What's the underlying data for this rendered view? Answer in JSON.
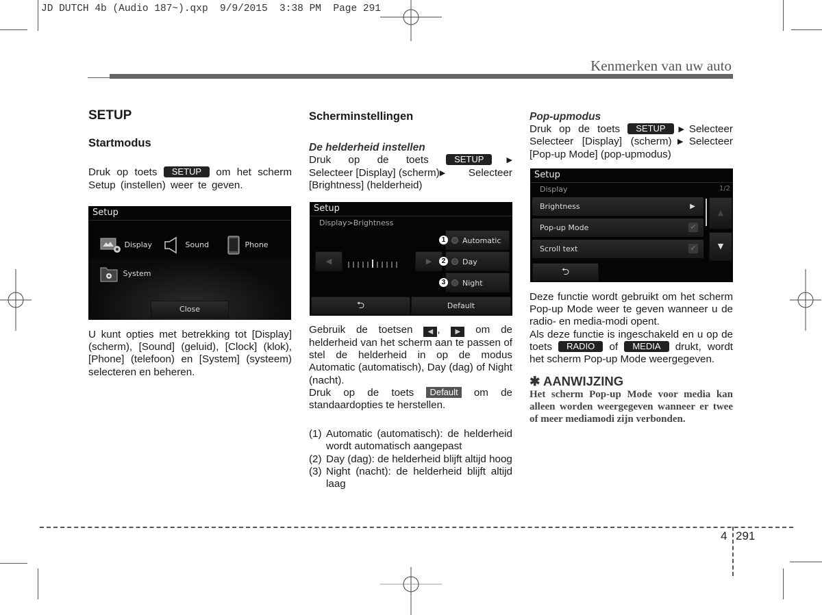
{
  "slug": "JD DUTCH 4b (Audio 187~).qxp  9/9/2015  3:38 PM  Page 291",
  "header": {
    "section_title": "Kenmerken van uw auto"
  },
  "col1": {
    "title": "SETUP",
    "subtitle": "Startmodus",
    "para1_pre": "Druk op toets",
    "para1_key": "SETUP",
    "para1_post": "om het scherm Setup (instellen) weer te geven.",
    "screen": {
      "title": "Setup",
      "items": [
        {
          "label": "Display",
          "icon": "display-settings-icon"
        },
        {
          "label": "Sound",
          "icon": "speaker-icon"
        },
        {
          "label": "Phone",
          "icon": "phone-icon"
        },
        {
          "label": "System",
          "icon": "system-folder-icon"
        }
      ],
      "close_label": "Close"
    },
    "para2": "U kunt opties met betrekking tot [Display] (scherm), [Sound] (geluid), [Clock] (klok), [Phone] (telefoon) en [System] (systeem) selecteren en beheren."
  },
  "col2": {
    "title": "Scherminstellingen",
    "subtitle": "De helderheid instellen",
    "instr_pre": "Druk op de toets",
    "instr_key": "SETUP",
    "instr_mid": "Selecteer [Display] (scherm)",
    "instr_post": "Selecteer [Brightness] (helderheid)",
    "screen": {
      "title": "Setup",
      "breadcrumb": "Display>Brightness",
      "brightness_level": 5,
      "brightness_steps": 11,
      "modes": [
        {
          "num": "1",
          "label": "Automatic"
        },
        {
          "num": "2",
          "label": "Day"
        },
        {
          "num": "3",
          "label": "Night"
        }
      ],
      "back_icon": "back-arrow-icon",
      "default_label": "Default"
    },
    "para1_pre": "Gebruik de toetsen",
    "para1_post": "om de helderheid van het scherm aan te passen of stel de helderheid in op de modus Automatic (automatisch), Day (dag) of Night (nacht).",
    "para2_pre": "Druk op de toets",
    "para2_key": "Default",
    "para2_post": "om de standaardopties te herstellen.",
    "list": [
      {
        "num": "(1)",
        "text": "Automatic (automatisch): de helderheid wordt automatisch aangepast"
      },
      {
        "num": "(2)",
        "text": "Day (dag): de helderheid blijft altijd hoog"
      },
      {
        "num": "(3)",
        "text": "Night (nacht): de helderheid blijft altijd laag"
      }
    ]
  },
  "col3": {
    "subtitle": "Pop-upmodus",
    "instr_pre": "Druk op de toets",
    "instr_key": "SETUP",
    "instr_mid": "Selecteer [Display] (scherm)",
    "instr_post": "Selecteer [Pop-up Mode] (pop-upmodus)",
    "screen": {
      "title": "Setup",
      "section": "Display",
      "page": "1/2",
      "rows": [
        {
          "label": "Brightness",
          "type": "arrow"
        },
        {
          "label": "Pop-up Mode",
          "type": "check"
        },
        {
          "label": "Scroll text",
          "type": "check"
        }
      ]
    },
    "para1": "Deze functie wordt gebruikt om het scherm Pop-up Mode weer te geven wanneer u de radio- en media-modi opent.",
    "para2_pre": "Als deze functie is ingeschakeld en u op de toets",
    "para2_key1": "RADIO",
    "para2_of": "of",
    "para2_key2": "MEDIA",
    "para2_post": "drukt, wordt het scherm Pop-up Mode weergegeven.",
    "note_title": "✱ AANWIJZING",
    "note_text": "Het scherm Pop-up Mode voor media kan alleen worden weergegeven wanneer er twee of meer mediamodi zijn verbonden."
  },
  "footer": {
    "chapter": "4",
    "page": "291"
  }
}
